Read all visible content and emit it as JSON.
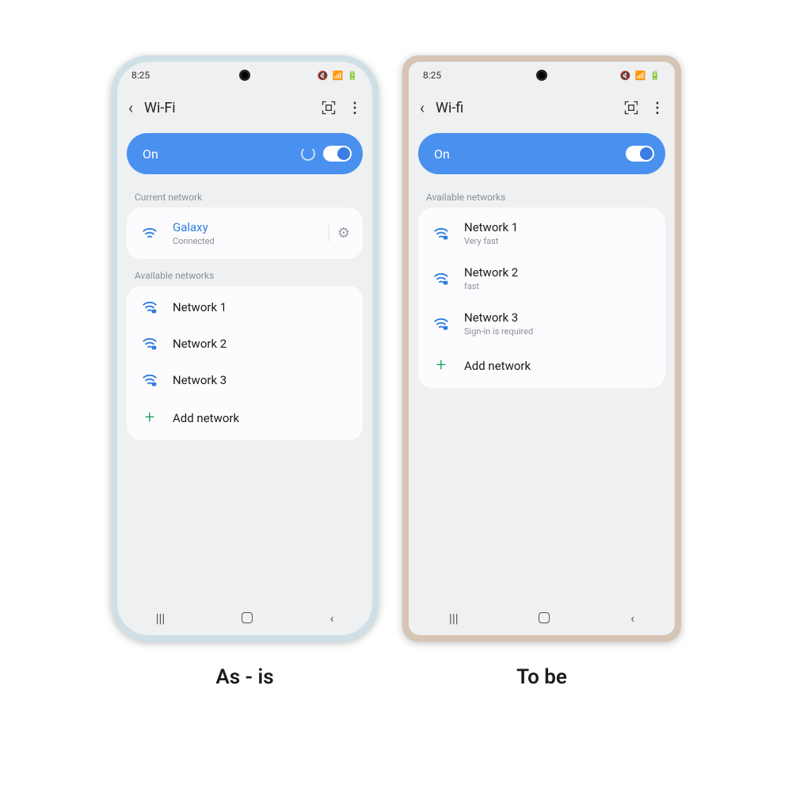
{
  "left": {
    "status_time": "8:25",
    "header_title": "Wi-Fi",
    "toggle_label": "On",
    "show_spinner": true,
    "current_section_label": "Current network",
    "current_network": {
      "name": "Galaxy",
      "status": "Connected"
    },
    "available_section_label": "Available networks",
    "available": [
      {
        "name": "Network 1",
        "sub": ""
      },
      {
        "name": "Network 2",
        "sub": ""
      },
      {
        "name": "Network 3",
        "sub": ""
      }
    ],
    "add_label": "Add network",
    "caption": "As - is"
  },
  "right": {
    "status_time": "8:25",
    "header_title": "Wi-fi",
    "toggle_label": "On",
    "show_spinner": false,
    "available_section_label": "Available networks",
    "available": [
      {
        "name": "Network 1",
        "sub": "Very fast"
      },
      {
        "name": "Network 2",
        "sub": "fast"
      },
      {
        "name": "Network 3",
        "sub": "Sign-in is required"
      }
    ],
    "add_label": "Add network",
    "caption": "To be"
  },
  "colors": {
    "accent": "#4a90ef",
    "wifi_icon": "#2f7de1",
    "plus": "#0a9b4d"
  }
}
